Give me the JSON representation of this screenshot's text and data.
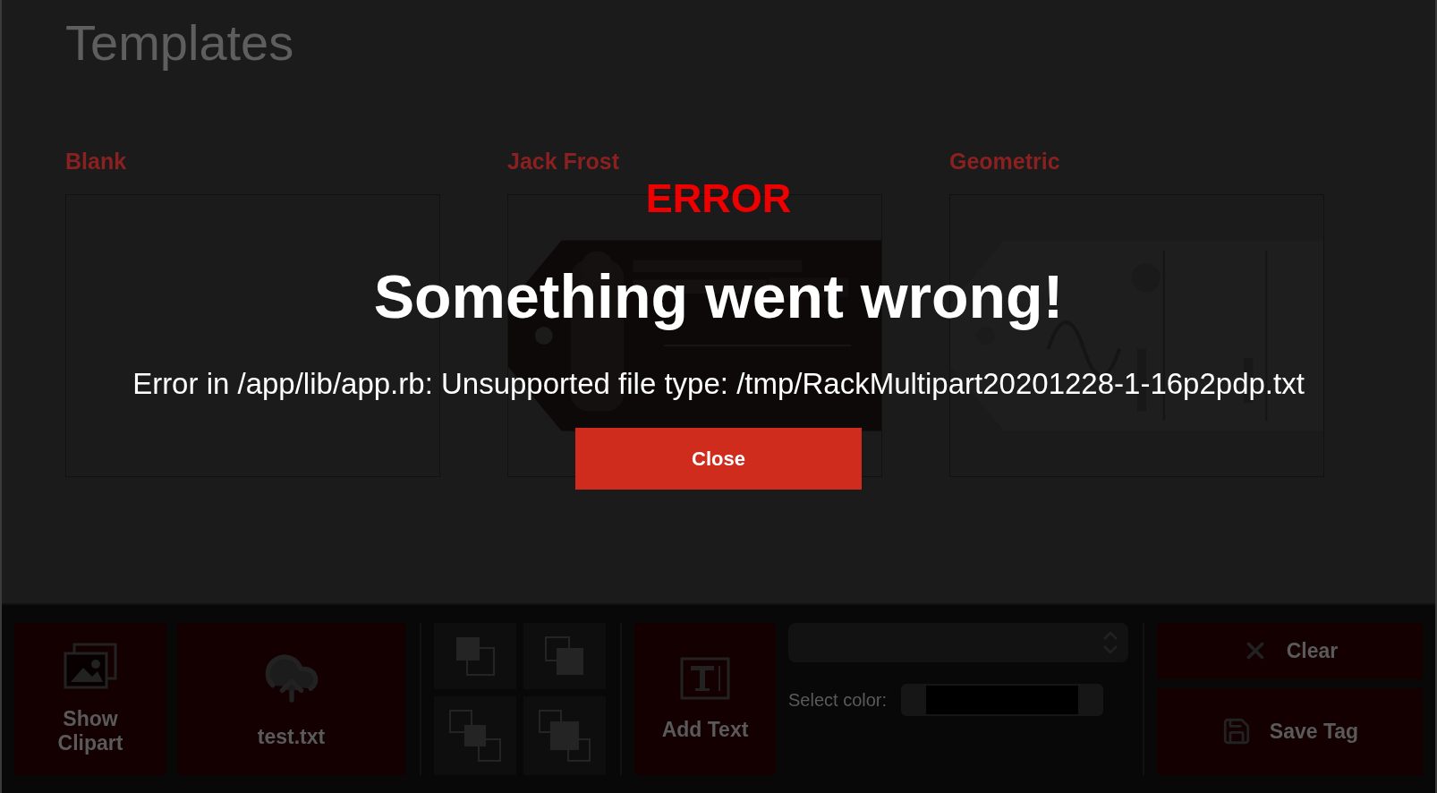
{
  "page": {
    "title": "Templates"
  },
  "templates": [
    {
      "name": "Blank",
      "kind": "blank"
    },
    {
      "name": "Jack Frost",
      "kind": "picture"
    },
    {
      "name": "Geometric",
      "kind": "picture"
    }
  ],
  "toolbar": {
    "clipart_button": {
      "label": "Show Clipart"
    },
    "upload_button": {
      "label": "test.txt"
    },
    "layer_buttons": [
      {
        "kind": "back"
      },
      {
        "kind": "front"
      },
      {
        "kind": "backward"
      },
      {
        "kind": "forward"
      }
    ],
    "add_text_button": {
      "label": "Add Text"
    },
    "color_label": "Select color:",
    "actions": [
      {
        "kind": "clear",
        "label": "Clear"
      },
      {
        "kind": "save",
        "label": "Save Tag"
      }
    ]
  },
  "dialog": {
    "heading": "ERROR",
    "title": "Something went wrong!",
    "message": "Error in /app/lib/app.rb: Unsupported file type: /tmp/RackMultipart20201228-1-16p2pdp.txt",
    "button": "Close"
  }
}
